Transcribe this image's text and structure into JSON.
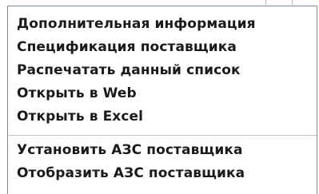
{
  "menu": {
    "items": [
      {
        "label": "Дополнительная информация"
      },
      {
        "label": "Спецификация поставщика"
      },
      {
        "label": "Распечатать данный список"
      },
      {
        "label": "Открыть в Web"
      },
      {
        "label": "Открыть в Excel"
      },
      {
        "label": "Установить АЗС поставщика"
      },
      {
        "label": "Отобразить АЗС поставщика"
      }
    ]
  },
  "colors": {
    "menu_background": "#ffffff",
    "menu_border": "#7a8a99",
    "separator": "#b8c2cc",
    "text": "#1a1a1a"
  }
}
